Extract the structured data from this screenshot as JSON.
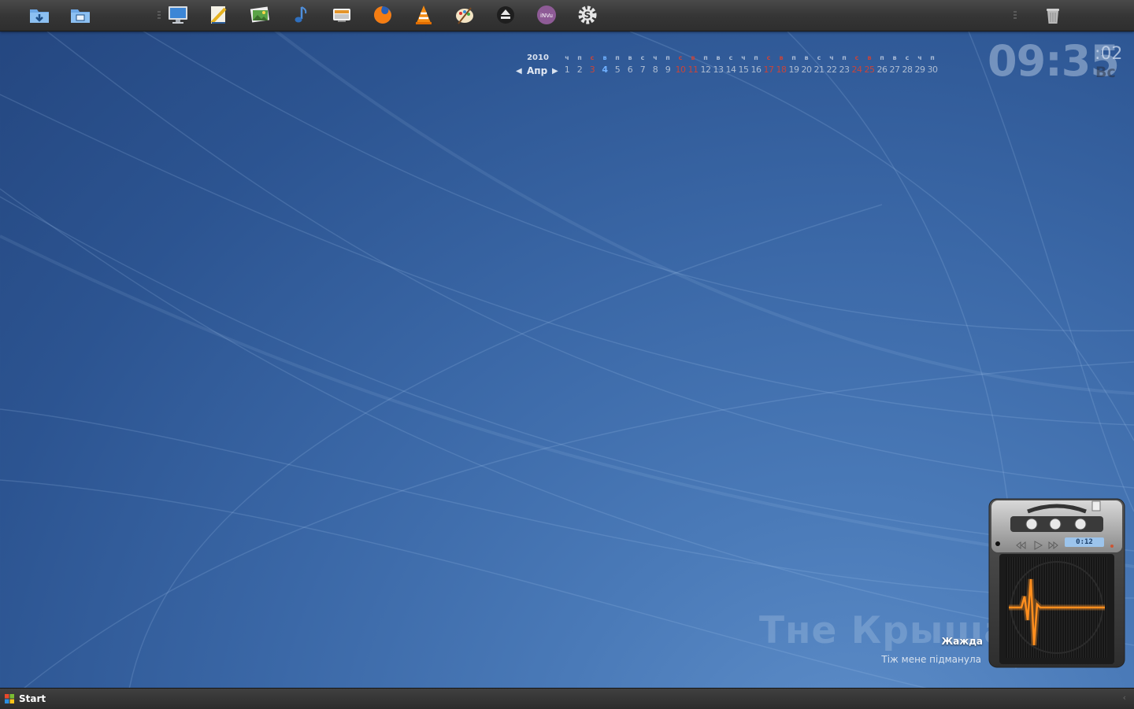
{
  "dock": {
    "left_icons": [
      "downloads-folder-icon",
      "documents-folder-icon"
    ],
    "apps": [
      "computer-icon",
      "office-ruler-icon",
      "image-viewer-icon",
      "music-note-icon",
      "screenshot-icon",
      "firefox-icon",
      "vlc-icon",
      "paint-icon",
      "eject-icon",
      "nvu-icon",
      "settings-gear-icon"
    ],
    "right_icons": [
      "trash-icon"
    ]
  },
  "calendar": {
    "year": "2010",
    "month": "Апр",
    "prev": "◀",
    "next": "▶",
    "days": [
      {
        "dow": "ч",
        "num": "1"
      },
      {
        "dow": "п",
        "num": "2"
      },
      {
        "dow": "с",
        "num": "3"
      },
      {
        "dow": "в",
        "num": "4"
      },
      {
        "dow": "п",
        "num": "5"
      },
      {
        "dow": "в",
        "num": "6"
      },
      {
        "dow": "с",
        "num": "7"
      },
      {
        "dow": "ч",
        "num": "8"
      },
      {
        "dow": "п",
        "num": "9"
      },
      {
        "dow": "с",
        "num": "10"
      },
      {
        "dow": "в",
        "num": "11"
      },
      {
        "dow": "п",
        "num": "12"
      },
      {
        "dow": "в",
        "num": "13"
      },
      {
        "dow": "с",
        "num": "14"
      },
      {
        "dow": "ч",
        "num": "15"
      },
      {
        "dow": "п",
        "num": "16"
      },
      {
        "dow": "с",
        "num": "17"
      },
      {
        "dow": "в",
        "num": "18"
      },
      {
        "dow": "п",
        "num": "19"
      },
      {
        "dow": "в",
        "num": "20"
      },
      {
        "dow": "с",
        "num": "21"
      },
      {
        "dow": "ч",
        "num": "22"
      },
      {
        "dow": "п",
        "num": "23"
      },
      {
        "dow": "с",
        "num": "24"
      },
      {
        "dow": "в",
        "num": "25"
      },
      {
        "dow": "п",
        "num": "26"
      },
      {
        "dow": "в",
        "num": "27"
      },
      {
        "dow": "с",
        "num": "28"
      },
      {
        "dow": "ч",
        "num": "29"
      },
      {
        "dow": "п",
        "num": "30"
      }
    ],
    "weekend_days": [
      "3",
      "10",
      "11",
      "17",
      "18",
      "24",
      "25"
    ],
    "today": "4",
    "colors": {
      "weekend": "#c9443a",
      "today": "#6fb0ff"
    }
  },
  "clock": {
    "hours_minutes": "09:35",
    "seconds": ":02",
    "weekday": "Вс"
  },
  "player": {
    "artist": "Тне Крыша",
    "song": "Жажда",
    "album": "Тіж мене підманула",
    "time": "0:12",
    "controls": [
      "rewind-icon",
      "play-icon",
      "fast-forward-icon"
    ]
  },
  "taskbar": {
    "start_label": "Start",
    "tray_arrow": "‹"
  },
  "colors": {
    "wallpaper": "#3a67a6",
    "taskbar": "#333333",
    "waveform": "#ff8a1a"
  }
}
